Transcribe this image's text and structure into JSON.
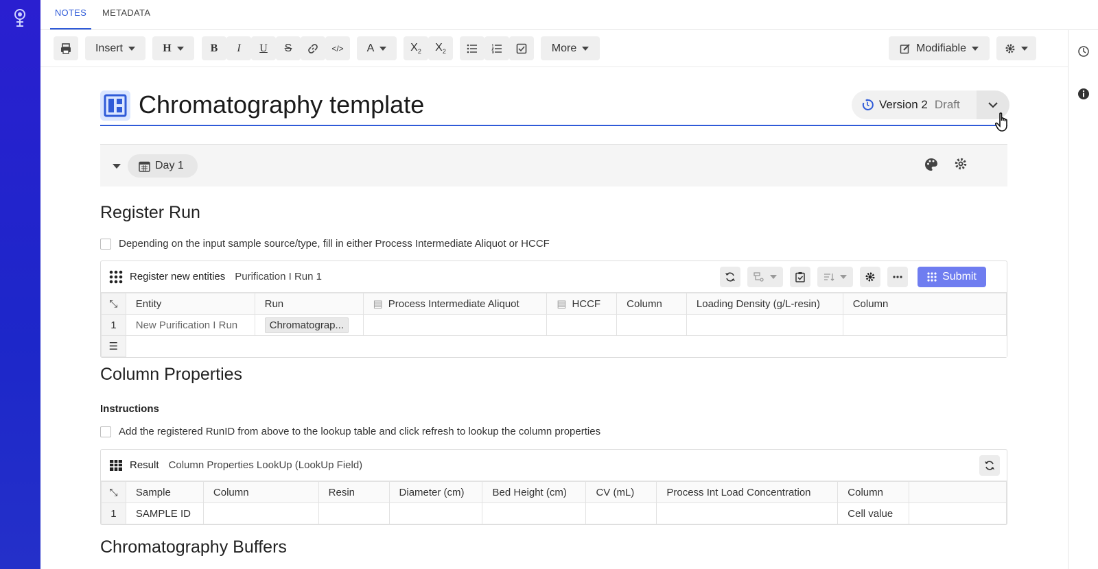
{
  "tabs": [
    {
      "label": "NOTES"
    },
    {
      "label": "METADATA"
    }
  ],
  "toolbar": {
    "insert_label": "Insert",
    "heading_label": "H",
    "more_label": "More",
    "modifiable_label": "Modifiable"
  },
  "title": {
    "text": "Chromatography template",
    "version_label": "Version 2",
    "status_label": "Draft"
  },
  "day": {
    "label": "Day 1"
  },
  "register_run": {
    "heading": "Register Run",
    "instruction": "Depending on the input sample source/type, fill in either Process Intermediate Aliquot or HCCF",
    "panel_title": "Register new entities",
    "panel_subtitle": "Purification I Run 1",
    "submit_label": "Submit",
    "columns": [
      "Entity",
      "Run",
      "Process Intermediate Aliquot",
      "HCCF",
      "Column",
      "Loading Density (g/L-resin)",
      "Column"
    ],
    "rows": [
      {
        "num": "1",
        "entity": "New Purification I Run",
        "run": "Chromatograp..."
      }
    ]
  },
  "column_properties": {
    "heading": "Column Properties",
    "instructions_label": "Instructions",
    "instruction": "Add the registered RunID from above to the lookup table and click refresh to lookup the column properties",
    "panel_title": "Result",
    "panel_subtitle": "Column Properties LookUp (LookUp Field)",
    "columns": [
      "Sample",
      "Column",
      "Resin",
      "Diameter (cm)",
      "Bed Height (cm)",
      "CV (mL)",
      "Process Int Load Concentration",
      "Column"
    ],
    "rows": [
      {
        "num": "1",
        "sample": "SAMPLE ID",
        "column2": "Cell value"
      }
    ]
  },
  "buffers": {
    "heading": "Chromatography Buffers"
  },
  "colors": {
    "accent": "#2f5bd8",
    "rail": "#1d27c9",
    "submit": "#6f7df0"
  }
}
